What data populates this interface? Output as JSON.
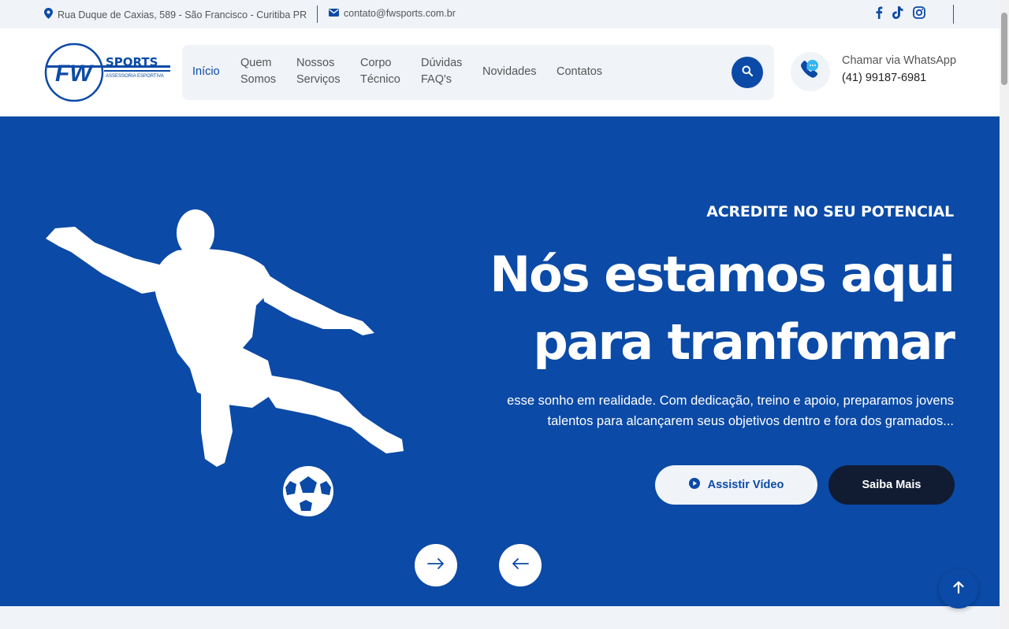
{
  "topbar": {
    "address": "Rua Duque de Caxias, 589 - São Francisco - Curitiba PR",
    "email": "contato@fwsports.com.br",
    "socials": [
      "facebook-icon",
      "tiktok-icon",
      "instagram-icon"
    ]
  },
  "logo": {
    "mark": "FW",
    "name": "SPORTS",
    "tagline": "ASSESSORIA ESPORTIVA"
  },
  "nav": {
    "items": [
      {
        "line1": "Início",
        "line2": ""
      },
      {
        "line1": "Quem",
        "line2": "Somos"
      },
      {
        "line1": "Nossos",
        "line2": "Serviços"
      },
      {
        "line1": "Corpo",
        "line2": "Técnico"
      },
      {
        "line1": "Dúvidas",
        "line2": "FAQ's"
      },
      {
        "line1": "Novidades",
        "line2": ""
      },
      {
        "line1": "Contatos",
        "line2": ""
      }
    ],
    "active_index": 0
  },
  "whatsapp": {
    "label": "Chamar via WhatsApp",
    "phone": "(41) 99187-6981"
  },
  "hero": {
    "kicker": "ACREDITE NO SEU POTENCIAL",
    "headline_line1": "Nós estamos aqui",
    "headline_line2": "para tranformar",
    "desc_line1": "esse sonho em realidade. Com dedicação, treino e apoio, preparamos jovens",
    "desc_line2": "talentos para alcançarem seus objetivos dentro e fora dos gramados...",
    "btn_video": "Assistir Vídeo",
    "btn_more": "Saiba Mais"
  },
  "colors": {
    "brand": "#0b4aa6",
    "dark": "#111c33",
    "light": "#f0f3f8"
  }
}
